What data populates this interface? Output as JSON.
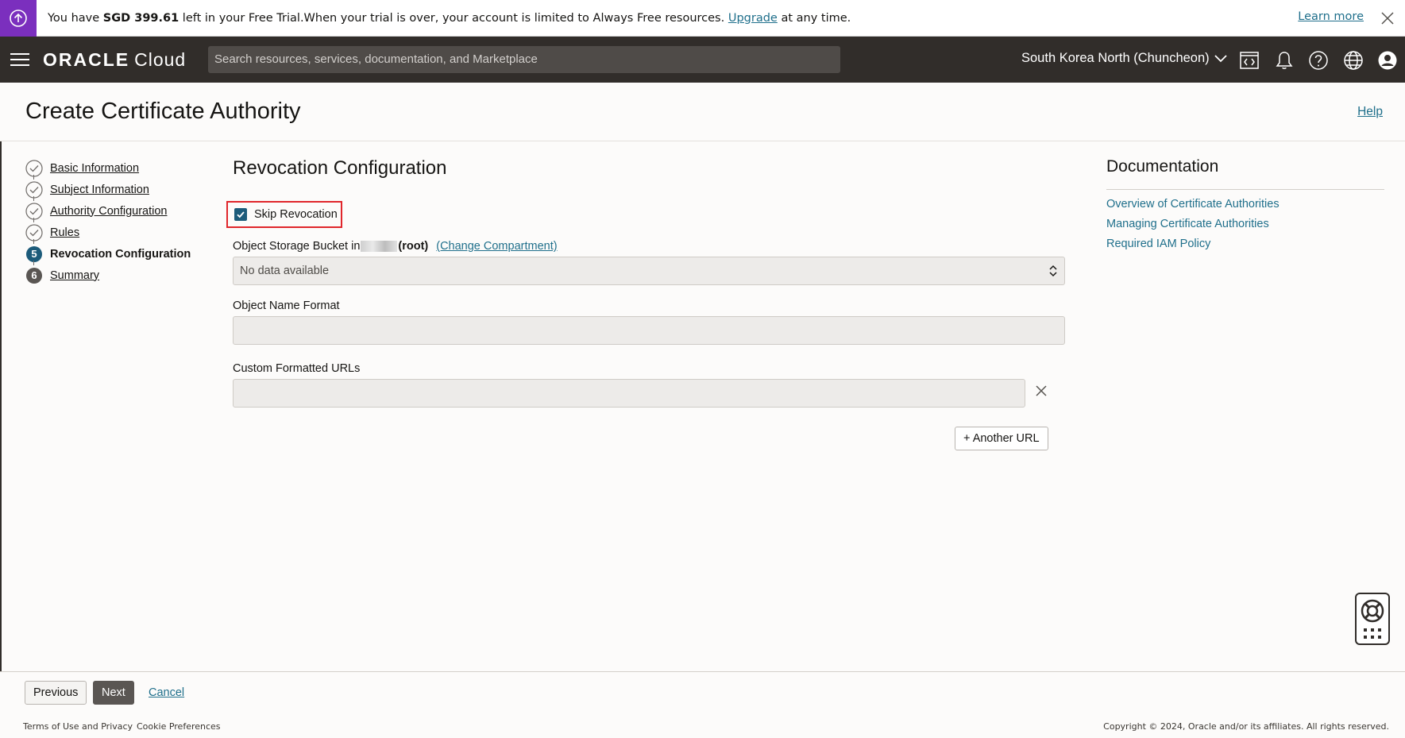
{
  "banner": {
    "prefix": "You have ",
    "amount": "SGD 399.61",
    "middle": " left in your Free Trial.When your trial is over, your account is limited to Always Free resources. ",
    "upgrade_link": "Upgrade",
    "suffix": " at any time.",
    "learn_more": "Learn more"
  },
  "header": {
    "logo_brand": "ORACLE",
    "logo_product": "Cloud",
    "search_placeholder": "Search resources, services, documentation, and Marketplace",
    "region": "South Korea North (Chuncheon)"
  },
  "page": {
    "title": "Create Certificate Authority",
    "help": "Help"
  },
  "steps": [
    {
      "label": "Basic Information",
      "state": "complete"
    },
    {
      "label": "Subject Information",
      "state": "complete"
    },
    {
      "label": "Authority Configuration",
      "state": "complete"
    },
    {
      "label": "Rules",
      "state": "complete"
    },
    {
      "label": "Revocation Configuration",
      "state": "current",
      "number": "5"
    },
    {
      "label": "Summary",
      "state": "upcoming",
      "number": "6"
    }
  ],
  "form": {
    "heading": "Revocation Configuration",
    "skip_revocation": {
      "label": "Skip Revocation",
      "checked": true
    },
    "bucket": {
      "label": "Object Storage Bucket in",
      "compartment": "(root)",
      "change_link": "(Change Compartment)",
      "value": "No data available"
    },
    "object_name_format": {
      "label": "Object Name Format",
      "value": ""
    },
    "custom_urls": {
      "label": "Custom Formatted URLs",
      "value": ""
    },
    "another_url_button": "+ Another URL"
  },
  "documentation": {
    "heading": "Documentation",
    "links": [
      "Overview of Certificate Authorities",
      "Managing Certificate Authorities",
      "Required IAM Policy"
    ]
  },
  "actions": {
    "previous": "Previous",
    "next": "Next",
    "cancel": "Cancel"
  },
  "footer": {
    "terms": "Terms of Use and Privacy",
    "cookies": "Cookie Preferences",
    "copyright": "Copyright © 2024, Oracle and/or its affiliates. All rights reserved."
  },
  "colors": {
    "header_bg": "#312d2a",
    "banner_badge": "#7b2fbe",
    "link": "#1f6f8b",
    "checkbox": "#1c5b7a",
    "highlight": "#e0262b"
  }
}
